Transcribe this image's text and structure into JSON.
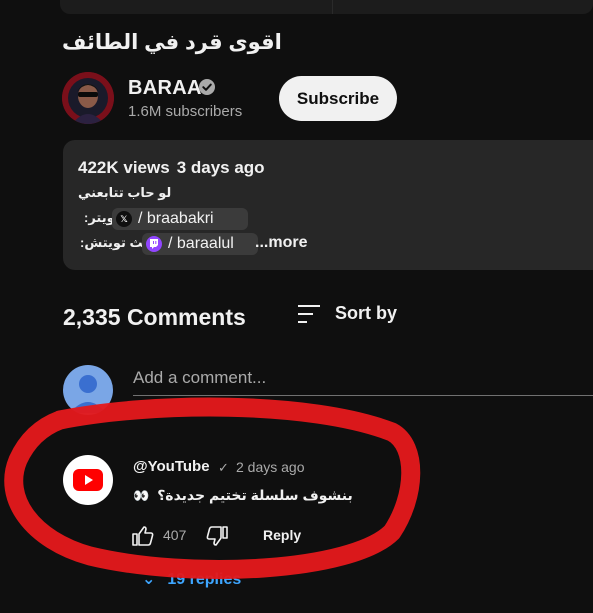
{
  "video": {
    "title": "اقوى قرد في الطائف"
  },
  "channel": {
    "name": "BARAA",
    "subscribers": "1.6M subscribers",
    "subscribe_label": "Subscribe",
    "avatar_color": "#7a0f1a"
  },
  "description": {
    "views": "422K views",
    "date": "3 days ago",
    "line1": "لو حاب تتابعني",
    "twitter_label": "تويتر:",
    "twitter_handle": "/ braabakri",
    "twitch_label": "بث تويتش:",
    "twitch_handle": "/ baraalul",
    "more_label": "...more"
  },
  "comments": {
    "count": "2,335 Comments",
    "sort_label": "Sort by",
    "add_placeholder": "Add a comment...",
    "items": [
      {
        "author": "@YouTube",
        "time": "2 days ago",
        "text": "بنشوف سلسلة تختيم جديدة؟",
        "emoji": "👀",
        "likes": "407",
        "reply_label": "Reply",
        "replies_label": "19 replies"
      }
    ]
  },
  "colors": {
    "background": "#0f0f0f",
    "panel": "#272727",
    "link_blue": "#3ea6ff",
    "brand_red": "#ff0000",
    "annotation_red": "#e3191c"
  },
  "icons": {
    "verified": "verified-check-icon",
    "sort": "sort-lines-icon",
    "like": "thumbs-up-icon",
    "dislike": "thumbs-down-icon",
    "x_logo": "x-logo-icon",
    "twitch_logo": "twitch-logo-icon",
    "youtube_logo": "youtube-logo-icon",
    "replies": "chevron-down-icon"
  }
}
